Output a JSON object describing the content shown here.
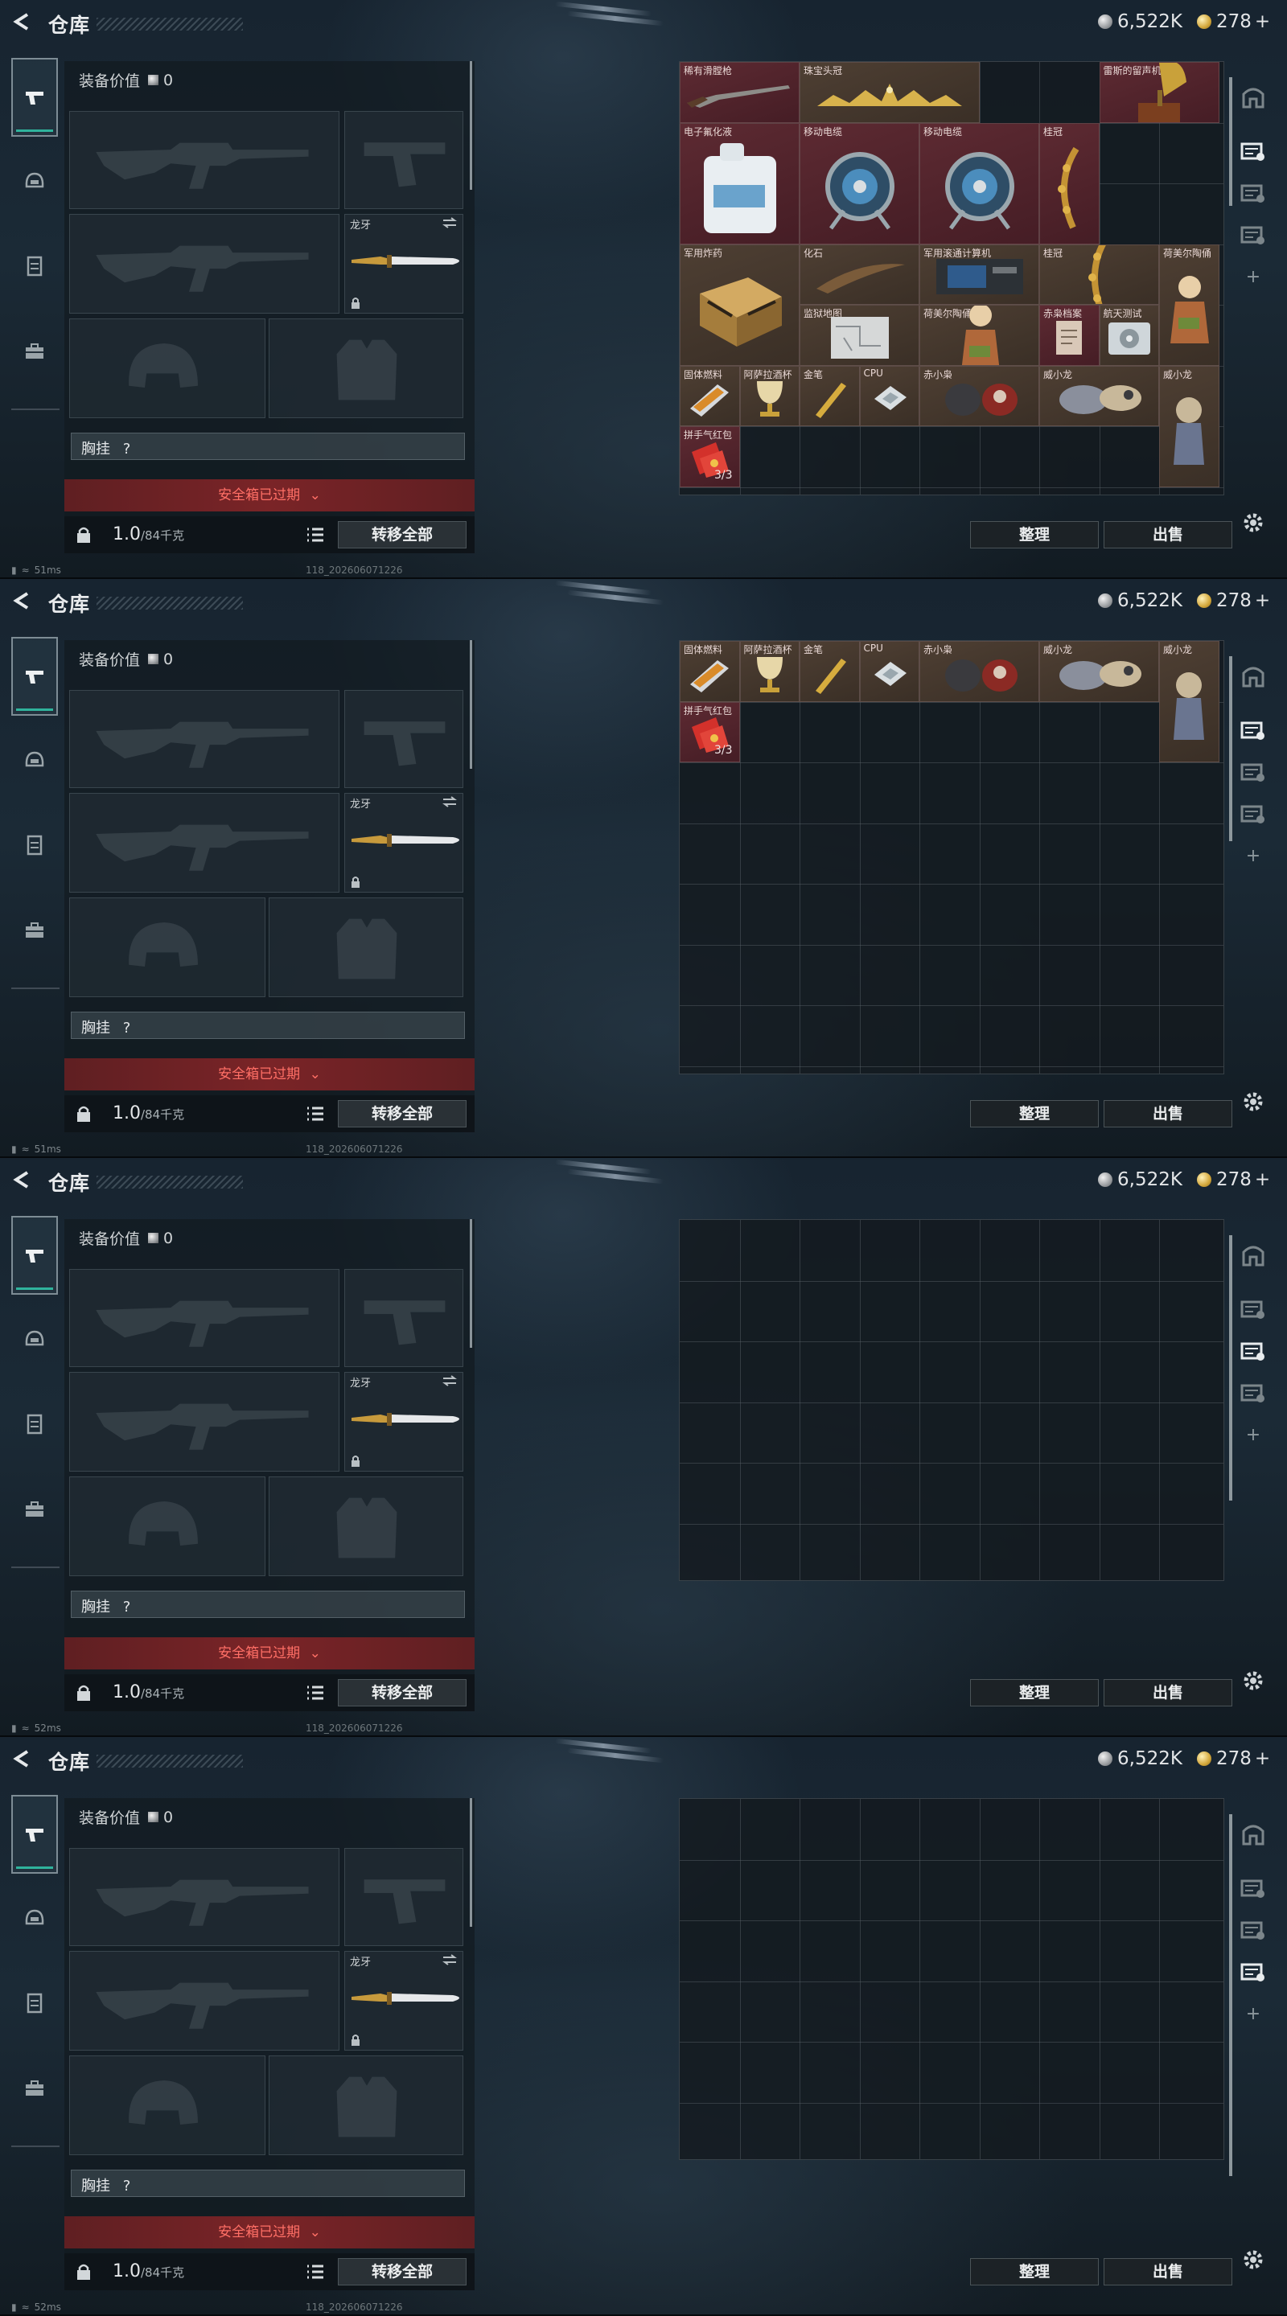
{
  "header": {
    "title": "仓库",
    "silver": "6,522K",
    "gold": "278"
  },
  "left_tabs": [
    "pistol-icon",
    "helmet-icon",
    "vest-icon",
    "briefcase-icon"
  ],
  "loadout": {
    "equip_value_label": "装备价值",
    "equip_value": "0",
    "melee_name": "龙牙",
    "chest_rig_label": "胸挂",
    "chest_rig_value": "?",
    "safe_box_text": "安全箱已过期",
    "weight": "1.0",
    "weight_max": "/84千克",
    "transfer_all": "转移全部"
  },
  "stash": {
    "sort_label": "整理",
    "sell_label": "出售",
    "items": [
      {
        "name": "稀有滑膛枪",
        "icon": "musket-icon"
      },
      {
        "name": "珠宝头冠",
        "icon": "tiara-icon"
      },
      {
        "name": "雷斯的留声机",
        "icon": "gramophone-icon"
      },
      {
        "name": "电子氟化液",
        "icon": "jerrycan-icon"
      },
      {
        "name": "移动电缆",
        "icon": "cable-reel-icon"
      },
      {
        "name": "移动电缆",
        "icon": "cable-reel-icon"
      },
      {
        "name": "桂冠",
        "icon": "laurel-icon"
      },
      {
        "name": "军用炸药",
        "icon": "explosive-crate-icon"
      },
      {
        "name": "化石",
        "icon": "fossil-icon"
      },
      {
        "name": "军用滚通计算机",
        "icon": "computer-icon"
      },
      {
        "name": "桂冠",
        "icon": "laurel-icon"
      },
      {
        "name": "荷美尔陶俑",
        "icon": "figurine-icon"
      },
      {
        "name": "监狱地图",
        "icon": "map-icon"
      },
      {
        "name": "荷美尔陶俑",
        "icon": "figurine-icon"
      },
      {
        "name": "赤枭档案",
        "icon": "file-icon"
      },
      {
        "name": "航天测试",
        "icon": "drive-icon"
      },
      {
        "name": "固体燃料",
        "icon": "fuel-icon"
      },
      {
        "name": "阿萨拉酒杯",
        "icon": "goblet-icon"
      },
      {
        "name": "金笔",
        "icon": "pen-icon"
      },
      {
        "name": "CPU",
        "icon": "cpu-icon"
      },
      {
        "name": "赤小枭",
        "icon": "toy-owl-icon"
      },
      {
        "name": "威小龙",
        "icon": "toy-dragon-icon"
      },
      {
        "name": "威小龙",
        "icon": "toy-dragon-standing-icon"
      },
      {
        "name": "拼手气红包",
        "icon": "red-envelope-icon",
        "count": "3/3"
      }
    ]
  },
  "status": {
    "ping_1": "51ms",
    "ping_2": "51ms",
    "ping_3": "52ms",
    "ping_4": "52ms",
    "build": "118_202606071226"
  },
  "colors": {
    "accent_teal": "#2fb39c",
    "safe_box_red": "#ff6f66",
    "item_red_bg": "#5d2a32"
  }
}
